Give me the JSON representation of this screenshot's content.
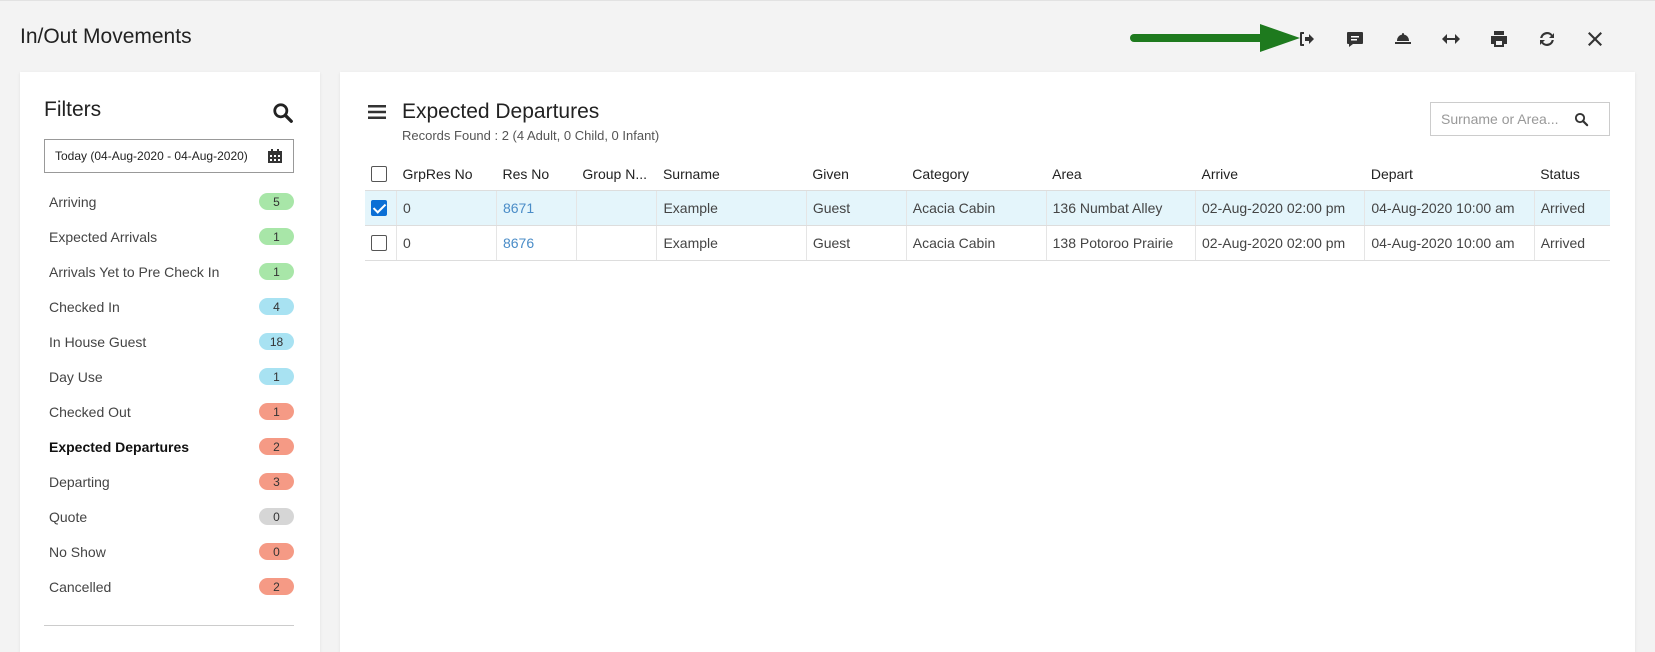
{
  "page": {
    "title": "In/Out Movements"
  },
  "toolbar": {
    "icons": [
      "check-out-icon",
      "message-icon",
      "service-bell-icon",
      "expand-icon",
      "print-icon",
      "refresh-icon",
      "close-icon"
    ],
    "annotation_color": "#1e7a1e"
  },
  "filters": {
    "title": "Filters",
    "date_range": "Today (04-Aug-2020 - 04-Aug-2020)",
    "items": [
      {
        "label": "Arriving",
        "count": "5",
        "color": "#a8e6a8"
      },
      {
        "label": "Expected Arrivals",
        "count": "1",
        "color": "#a8e6a8"
      },
      {
        "label": "Arrivals Yet to Pre Check In",
        "count": "1",
        "color": "#a8e6a8"
      },
      {
        "label": "Checked In",
        "count": "4",
        "color": "#a8e2f2"
      },
      {
        "label": "In House Guest",
        "count": "18",
        "color": "#a8e2f2"
      },
      {
        "label": "Day Use",
        "count": "1",
        "color": "#a8e2f2"
      },
      {
        "label": "Checked Out",
        "count": "1",
        "color": "#f59a85"
      },
      {
        "label": "Expected Departures",
        "count": "2",
        "color": "#f59a85"
      },
      {
        "label": "Departing",
        "count": "3",
        "color": "#f59a85"
      },
      {
        "label": "Quote",
        "count": "0",
        "color": "#d6d6d6"
      },
      {
        "label": "No Show",
        "count": "0",
        "color": "#f59a85"
      },
      {
        "label": "Cancelled",
        "count": "2",
        "color": "#f59a85"
      }
    ],
    "active_index": 7
  },
  "main": {
    "title": "Expected Departures",
    "records": "Records Found : 2 (4 Adult, 0 Child, 0 Infant)",
    "search_placeholder": "Surname or Area...",
    "columns": [
      "GrpRes No",
      "Res No",
      "Group N...",
      "Surname",
      "Given",
      "Category",
      "Area",
      "Arrive",
      "Depart",
      "Status"
    ],
    "rows": [
      {
        "checked": true,
        "cells": [
          "0",
          "8671",
          "",
          "Example",
          "Guest",
          "Acacia Cabin",
          "136 Numbat Alley",
          "02-Aug-2020 02:00 pm",
          "04-Aug-2020 10:00 am",
          "Arrived"
        ]
      },
      {
        "checked": false,
        "cells": [
          "0",
          "8676",
          "",
          "Example",
          "Guest",
          "Acacia Cabin",
          "138 Potoroo Prairie",
          "02-Aug-2020 02:00 pm",
          "04-Aug-2020 10:00 am",
          "Arrived"
        ]
      }
    ]
  }
}
